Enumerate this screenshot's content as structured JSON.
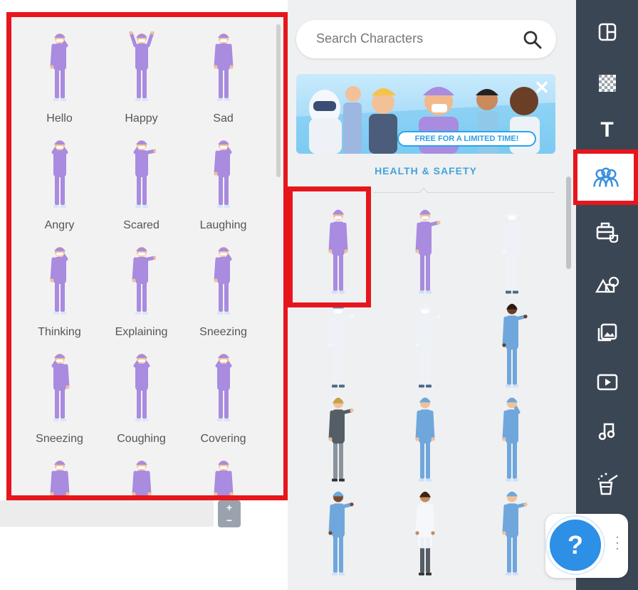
{
  "pose_panel": {
    "poses": [
      {
        "label": "Hello"
      },
      {
        "label": "Happy"
      },
      {
        "label": "Sad"
      },
      {
        "label": "Angry"
      },
      {
        "label": "Scared"
      },
      {
        "label": "Laughing"
      },
      {
        "label": "Thinking"
      },
      {
        "label": "Explaining"
      },
      {
        "label": "Sneezing"
      },
      {
        "label": "Sneezing"
      },
      {
        "label": "Coughing"
      },
      {
        "label": "Covering"
      }
    ],
    "character_color": "#a98be0"
  },
  "library": {
    "search_placeholder": "Search Characters",
    "banner": {
      "tag": "FREE FOR A LIMITED TIME!"
    },
    "section_title": "HEALTH & SAFETY",
    "characters": [
      {
        "icon": "character-purple-scrubs"
      },
      {
        "icon": "character-purple-scrubs-wave"
      },
      {
        "icon": "character-hazmat-suit"
      },
      {
        "icon": "character-hazmat-suit-blue-mask"
      },
      {
        "icon": "character-hazmat-suit-wave"
      },
      {
        "icon": "character-nurse-blue-scrubs"
      },
      {
        "icon": "character-man-casual"
      },
      {
        "icon": "character-doctor-blue-scrubs"
      },
      {
        "icon": "character-nurse-blue-scrubs-2"
      },
      {
        "icon": "character-doctor-dark-skin"
      },
      {
        "icon": "character-woman-lab-coat"
      },
      {
        "icon": "character-nurse-blue-scrubs-3"
      }
    ]
  },
  "sidebar": {
    "tools": [
      {
        "icon": "layout-icon"
      },
      {
        "icon": "background-icon"
      },
      {
        "icon": "text-icon",
        "glyph": "T"
      },
      {
        "icon": "characters-icon"
      },
      {
        "icon": "props-icon"
      },
      {
        "icon": "shapes-icon"
      },
      {
        "icon": "images-icon"
      },
      {
        "icon": "video-icon"
      },
      {
        "icon": "music-icon"
      },
      {
        "icon": "effects-icon"
      }
    ]
  },
  "help": {
    "label": "?"
  },
  "stepper": {
    "plus": "+",
    "minus": "−"
  }
}
